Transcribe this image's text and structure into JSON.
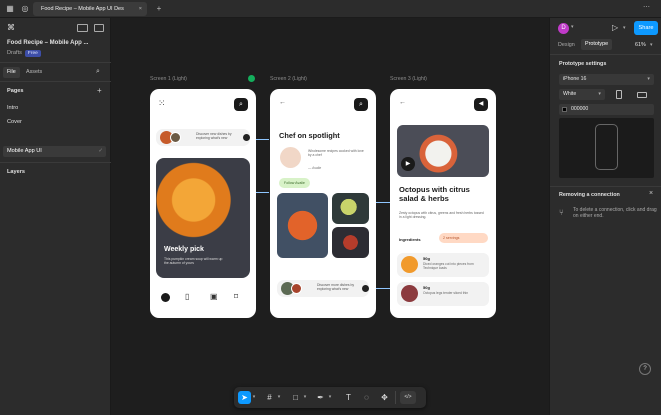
{
  "topbar": {
    "doc_tab_title": "Food Recipe – Mobile App UI Des",
    "close_glyph": "×",
    "new_tab_glyph": "+",
    "menu_glyph": "⋯"
  },
  "left_panel": {
    "file_name": "Food Recipe – Mobile App ...",
    "drafts": "Drafts",
    "plan_badge": "Free",
    "tab_file": "File",
    "tab_assets": "Assets",
    "pages_heading": "Pages",
    "pages": [
      "Intro",
      "Cover",
      "Mobile App UI"
    ],
    "layers_heading": "Layers"
  },
  "canvas": {
    "frame_labels": [
      "Screen 1 (Light)",
      "Screen 2 (Light)",
      "Screen 3 (Light)"
    ],
    "screen1": {
      "card_text": "Discover new dishes by exploring what's new",
      "feature_title": "Weekly pick",
      "feature_desc": "This pumpkin cream soup will warm up the autumn of yours"
    },
    "screen2": {
      "title": "Chef on spotlight",
      "quote": "Wholesome recipes cooked with love by a chef",
      "author": "— Avalie",
      "follow": "Follow Avalie",
      "card_text": "Discover more dishes by exploring what's new"
    },
    "screen3": {
      "title": "Octopus with citrus salad & herbs",
      "desc": "Zesty octopus with citrus, greens and fresh herbs tossed in a light dressing.",
      "ingredients_label": "Ingredients",
      "servings": "2 servings",
      "ingredients": [
        {
          "amount": "50g",
          "text": "Diced oranges cut into pieces from Technique loads"
        },
        {
          "amount": "50g",
          "text": "Octopus legs tender sliced thin"
        }
      ]
    }
  },
  "right_panel": {
    "avatar_letter": "D",
    "share_label": "Share",
    "tab_design": "Design",
    "tab_prototype": "Prototype",
    "zoom": "61%",
    "prototype_settings": "Prototype settings",
    "device": "iPhone 16",
    "color_mode": "White",
    "hex": "000000",
    "removing_heading": "Removing a connection",
    "removing_help": "To delete a connection, click and drag on either end."
  },
  "toolbar": {
    "code_label": "</>"
  },
  "colors": {
    "accent": "#0d99ff",
    "panel_bg": "#2c2c2c",
    "canvas_bg": "#1e1e1e",
    "connector": "#8fc6ff",
    "follow_green": "#d8f2c8",
    "servings_peach": "#ffd9c4"
  }
}
